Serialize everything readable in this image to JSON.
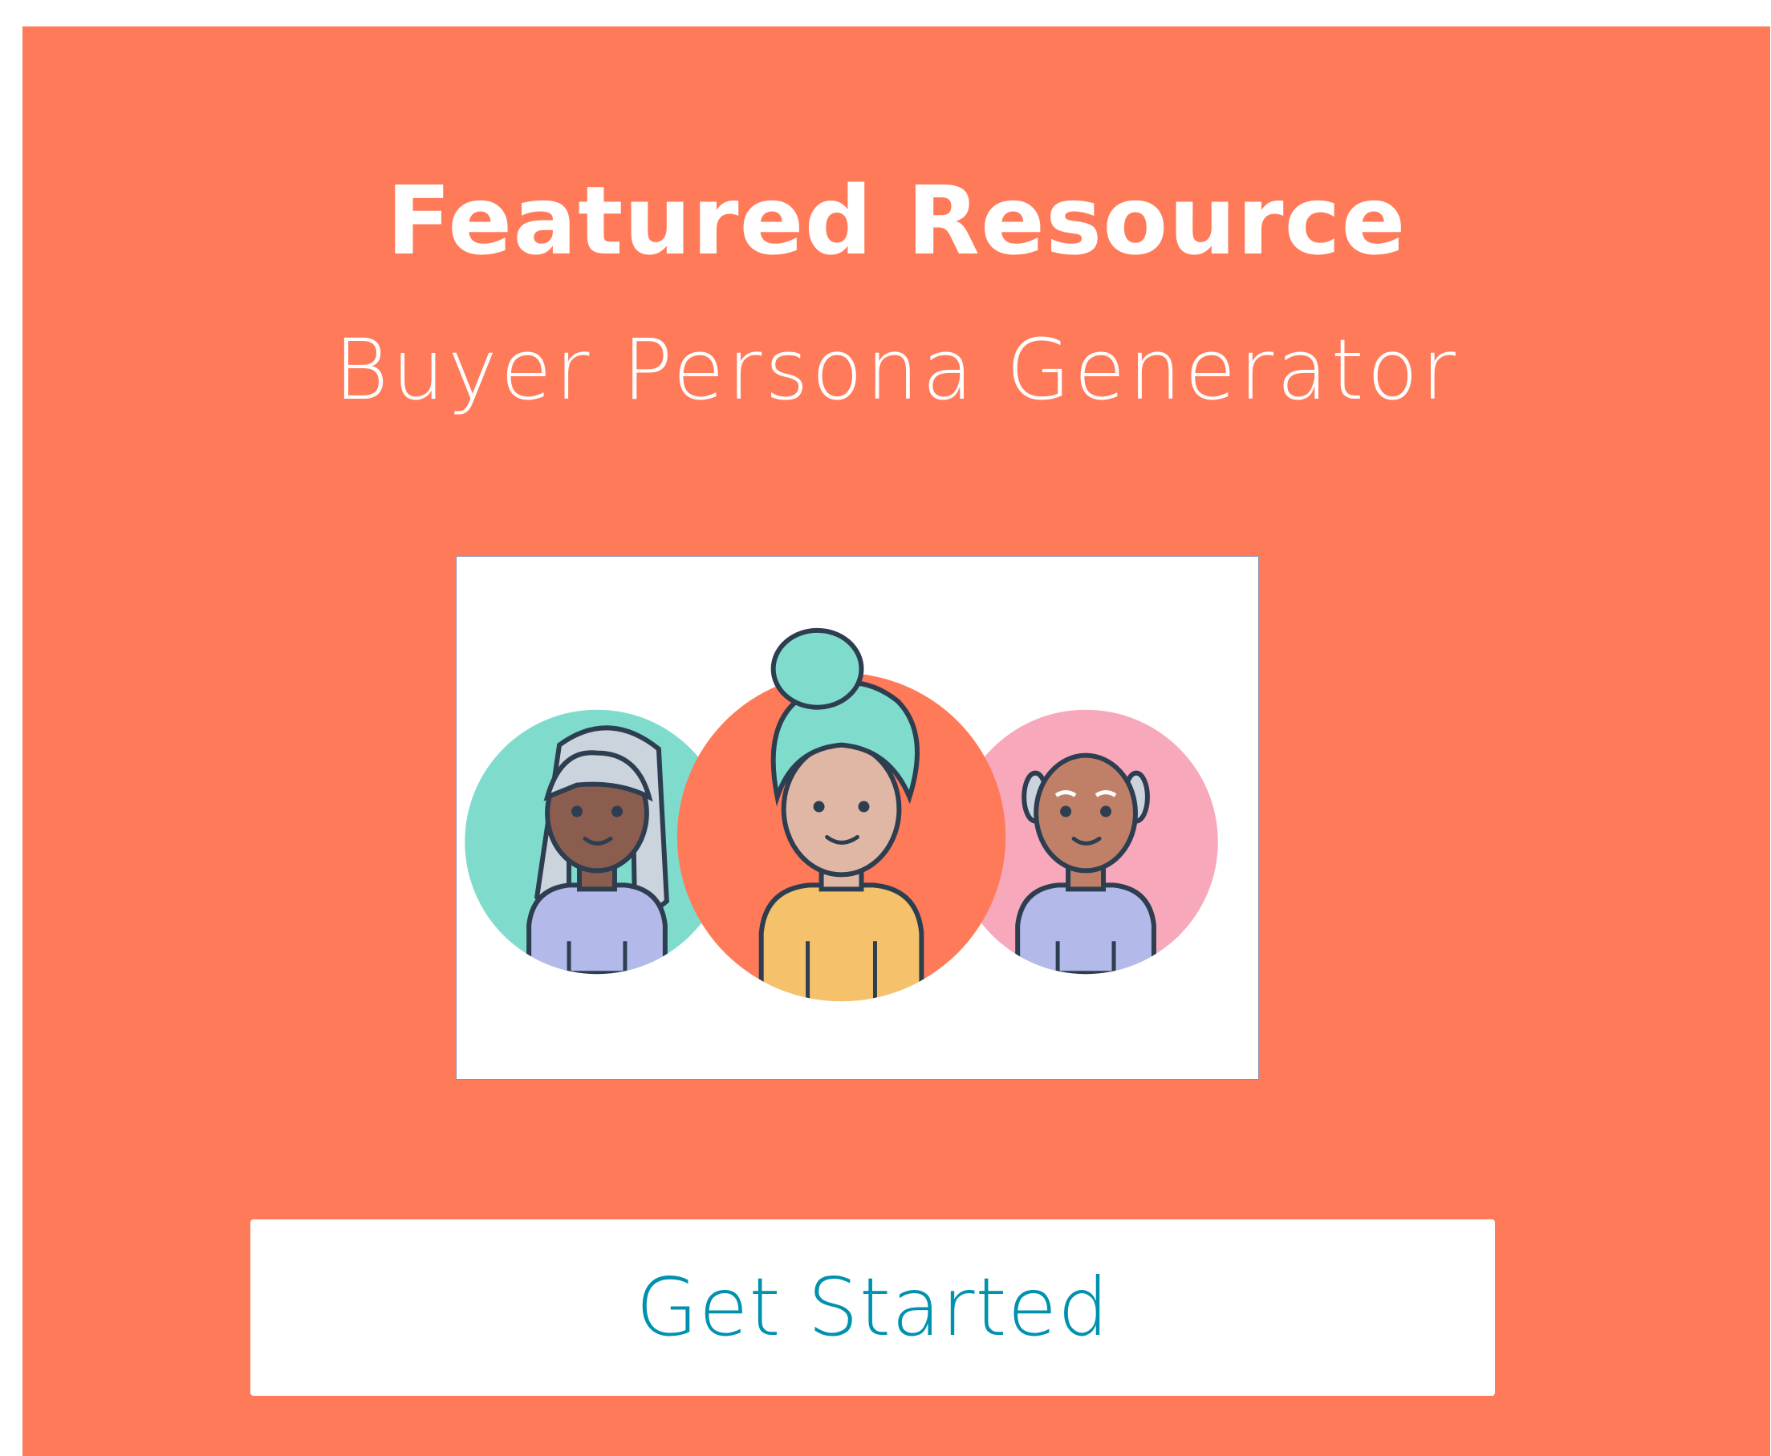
{
  "colors": {
    "card_background": "#ff7a59",
    "button_text": "#0091ae",
    "button_background": "#ffffff"
  },
  "banner": {
    "title": "Featured Resource",
    "subtitle": "Buyer Persona Generator",
    "illustration_icon": "three-personas-illustration",
    "cta_label": "Get Started"
  }
}
